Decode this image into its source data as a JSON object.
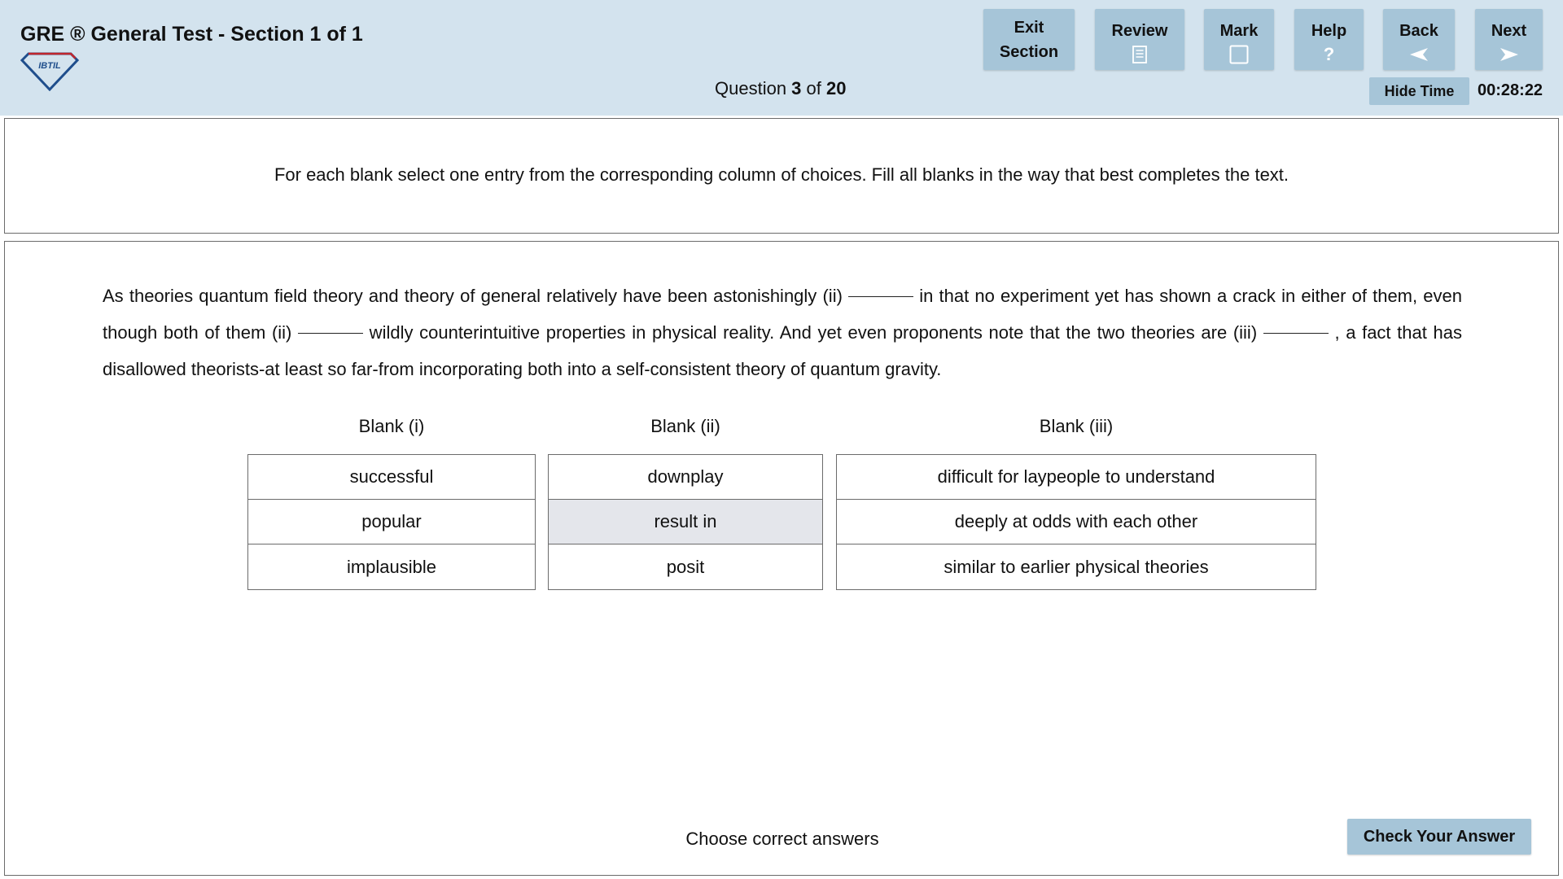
{
  "header": {
    "exam_title": "GRE ® General Test - Section 1 of 1",
    "logo_text": "IBTIL",
    "question_counter": {
      "prefix": "Question ",
      "current": "3",
      "middle": " of ",
      "total": "20"
    },
    "buttons": {
      "exit_line1": "Exit",
      "exit_line2": "Section",
      "review": "Review",
      "mark": "Mark",
      "help": "Help",
      "help_glyph": "?",
      "back": "Back",
      "next": "Next"
    },
    "hide_time": "Hide Time",
    "timer": "00:28:22"
  },
  "instruction": "For each blank select one entry from the corresponding column of choices. Fill all blanks in the way that best completes the text.",
  "passage": {
    "part1": "As theories quantum field theory and theory of general relatively have been astonishingly (ii) ",
    "part2": " in that no experiment yet has shown a crack in either of them, even though both of them (ii) ",
    "part3": " wildly counterintuitive properties in physical reality. And yet even proponents note that the two theories are (iii) ",
    "part4": " , a fact that has disallowed theorists-at least so far-from incorporating both into a self-consistent theory of quantum gravity."
  },
  "blanks": [
    {
      "header": "Blank (i)",
      "choices": [
        "successful",
        "popular",
        "implausible"
      ],
      "selected_index": null
    },
    {
      "header": "Blank (ii)",
      "choices": [
        "downplay",
        "result in",
        "posit"
      ],
      "selected_index": 1
    },
    {
      "header": "Blank (iii)",
      "choices": [
        "difficult for laypeople to understand",
        "deeply at odds with each other",
        "similar to earlier physical theories"
      ],
      "selected_index": null
    }
  ],
  "footer": {
    "prompt": "Choose correct answers",
    "check_button": "Check Your Answer"
  },
  "colors": {
    "header_bg": "#d3e3ee",
    "button_bg": "#a6c5d8",
    "selected_choice_bg": "#e4e6eb",
    "logo_blue": "#1f4e8c",
    "logo_red": "#c0262d"
  },
  "icons": {
    "review": "document-icon",
    "mark": "checkbox-icon",
    "help": "question-mark-icon",
    "back": "arrow-left-icon",
    "next": "arrow-right-icon"
  }
}
